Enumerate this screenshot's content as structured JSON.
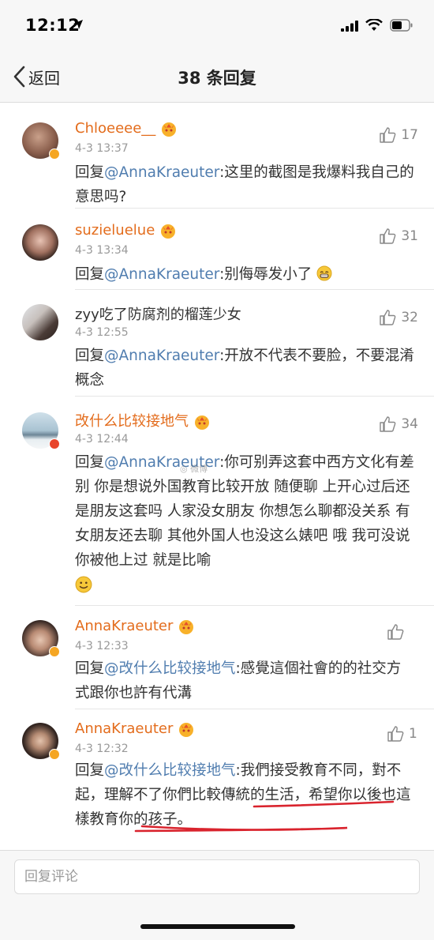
{
  "status_bar": {
    "time": "12:12"
  },
  "nav": {
    "back_label": "返回",
    "title": "38 条回复"
  },
  "comments": [
    {
      "name": "Chloeeee__",
      "time": "4-3 13:37",
      "likes": "17",
      "prefix": "回复",
      "mention": "@AnnaKraeuter",
      "text": ":这里的截图是我爆料我自己的意思吗?"
    },
    {
      "name": "suzieluelue",
      "time": "4-3 13:34",
      "likes": "31",
      "prefix": "回复",
      "mention": "@AnnaKraeuter",
      "text": ":别侮辱发小了"
    },
    {
      "name": "zyy吃了防腐剂的榴莲少女",
      "time": "4-3 12:55",
      "likes": "32",
      "prefix": "回复",
      "mention": "@AnnaKraeuter",
      "text": ":开放不代表不要脸，不要混淆概念"
    },
    {
      "name": "改什么比较接地气",
      "time": "4-3 12:44",
      "likes": "34",
      "prefix": "回复",
      "mention": "@AnnaKraeuter",
      "text": ":你可别弄这套中西方文化有差别 你是想说外国教育比较开放 随便聊 上开心过后还是朋友这套吗 人家没女朋友 你想怎么聊都没关系 有女朋友还去聊 其他外国人也没这么婊吧 哦 我可没说你被他上过 就是比喻"
    },
    {
      "name": "AnnaKraeuter",
      "time": "4-3 12:33",
      "likes": "",
      "prefix": "回复",
      "mention": "@改什么比较接地气",
      "text": ":感覺這個社會的的社交方式跟你也許有代溝"
    },
    {
      "name": "AnnaKraeuter",
      "time": "4-3 12:32",
      "likes": "1",
      "prefix": "回复",
      "mention": "@改什么比较接地气",
      "text": ":我們接受教育不同，對不起，理解不了你們比較傳統的生活，希望你以後也這樣教育你的孩子。"
    }
  ],
  "reply_box": {
    "placeholder": "回复评论"
  },
  "colors": {
    "name_orange": "#e36c1c",
    "mention_blue": "#507daf",
    "annotation_red": "#d9232d"
  }
}
